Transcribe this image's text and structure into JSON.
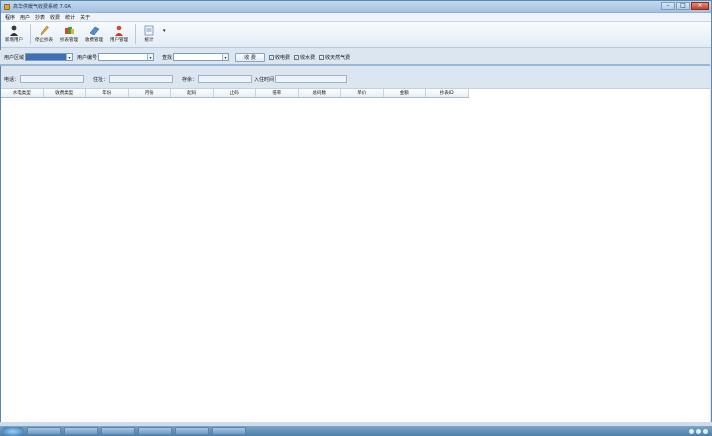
{
  "window": {
    "title": "高华供暖气收费系统 7.0A"
  },
  "menu": [
    "程序",
    "用户",
    "抄表",
    "收费",
    "统计",
    "关于"
  ],
  "toolbar": [
    {
      "label": "新增用户",
      "icon": "add-user-icon"
    },
    {
      "label": "停止抄表",
      "icon": "pencil-icon"
    },
    {
      "label": "抄表管理",
      "icon": "meter-icon"
    },
    {
      "label": "收费管理",
      "icon": "book-icon"
    },
    {
      "label": "用户管理",
      "icon": "user-icon"
    },
    {
      "label": "统计",
      "icon": "stats-icon"
    }
  ],
  "filter": {
    "area_label": "用户区域",
    "user_no_label": "用户编号",
    "search_label": "查找",
    "charge_button": "收 费",
    "check_electric": "收电费",
    "check_water": "收水费",
    "check_gas": "收天然气费"
  },
  "info": {
    "phone_label": "电话：",
    "address_label": "住址：",
    "deposit_label": "存余：",
    "checkin_label": "入住时间"
  },
  "grid": {
    "columns": [
      "水电类型",
      "收费类型",
      "年份",
      "月份",
      "起码",
      "止码",
      "倍率",
      "总码数",
      "单价",
      "金额",
      "抄表ID"
    ]
  },
  "colors": {
    "titlebar": "#a3c2e1",
    "selected_combo": "#3f6fb4",
    "workspace": "#ffffff"
  }
}
